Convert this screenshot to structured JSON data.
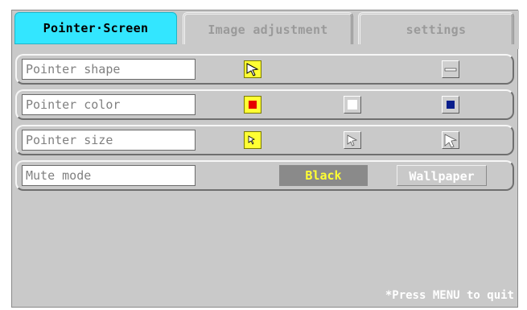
{
  "tabs": [
    {
      "label": "Pointer·Screen",
      "active": true
    },
    {
      "label": "Image adjustment",
      "active": false
    },
    {
      "label": "settings",
      "active": false
    }
  ],
  "rows": {
    "shape": {
      "label": "Pointer shape"
    },
    "color": {
      "label": "Pointer color",
      "options": [
        "red",
        "white",
        "blue"
      ]
    },
    "size": {
      "label": "Pointer size",
      "options": [
        "small",
        "medium",
        "large"
      ]
    },
    "mute": {
      "label": "Mute mode",
      "options": [
        "Black",
        "Wallpaper"
      ],
      "selected": "Black"
    }
  },
  "footer": "*Press MENU to quit",
  "colors": {
    "active_tab": "#33e6ff",
    "selection": "#ffff33",
    "panel": "#c9c9c9",
    "pointer_red": "#e60000",
    "pointer_blue": "#0a1e8c"
  }
}
